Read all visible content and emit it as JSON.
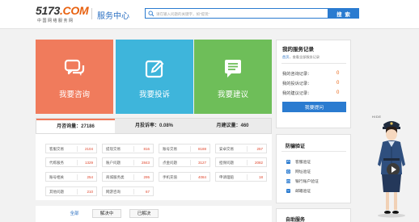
{
  "header": {
    "logo_main": "5173",
    "logo_com": ".COM",
    "logo_sub": "中国网络服务网",
    "service_title": "服务中心",
    "search_placeholder": "请在输入问题的关键字，如“提现”",
    "search_button": "搜 索"
  },
  "tiles": [
    {
      "label": "我要咨询",
      "icon": "chat-bubbles-icon",
      "color": "#f07b5c"
    },
    {
      "label": "我要投诉",
      "icon": "edit-pencil-icon",
      "color": "#3eb5db"
    },
    {
      "label": "我要建议",
      "icon": "message-lines-icon",
      "color": "#6ebe59"
    }
  ],
  "stats": {
    "consult": "月咨询量：27186",
    "complain": "月投诉率：0.08%",
    "suggest": "月建议量：460"
  },
  "categories": [
    {
      "name": "客服交易",
      "count": "2104"
    },
    {
      "name": "提现交易",
      "count": "816"
    },
    {
      "name": "账号交易",
      "count": "8188"
    },
    {
      "name": "安卓交易",
      "count": "257"
    },
    {
      "name": "代练服务",
      "count": "1329"
    },
    {
      "name": "账户问题",
      "count": "2843"
    },
    {
      "name": "点金问题",
      "count": "3127"
    },
    {
      "name": "担保问题",
      "count": "2082"
    },
    {
      "name": "账号相关",
      "count": "254"
    },
    {
      "name": "商城服务类",
      "count": "295"
    },
    {
      "name": "手机充值",
      "count": "4084"
    },
    {
      "name": "申请理赔",
      "count": "18"
    },
    {
      "name": "其他问题",
      "count": "210"
    },
    {
      "name": "网游咨询",
      "count": "67"
    }
  ],
  "filter_tabs": [
    "全部",
    "解决中",
    "已解决"
  ],
  "records": {
    "title": "我的服务记录",
    "sub_home": "首页",
    "sub_rest": "，查看全部服务记录",
    "rows": [
      {
        "label": "我的咨询记录：",
        "value": "0"
      },
      {
        "label": "我的投诉记录：",
        "value": "0"
      },
      {
        "label": "我的建议记录：",
        "value": "0"
      }
    ],
    "button": "我要提问"
  },
  "fraud": {
    "title": "防骗验证",
    "items": [
      {
        "label": "客服验证",
        "icon": "headset-icon"
      },
      {
        "label": "网址验证",
        "icon": "globe-icon"
      },
      {
        "label": "银行账户验证",
        "icon": "bank-card-icon"
      },
      {
        "label": "邮箱验证",
        "icon": "mail-icon"
      }
    ]
  },
  "self_service": {
    "title": "自助服务"
  },
  "mascot": {
    "tag": "HIDE"
  },
  "colors": {
    "brand_blue": "#2a7bd0",
    "accent_orange": "#e8610f",
    "tile_consult": "#f07b5c",
    "tile_complain": "#3eb5db",
    "tile_suggest": "#6ebe59"
  }
}
